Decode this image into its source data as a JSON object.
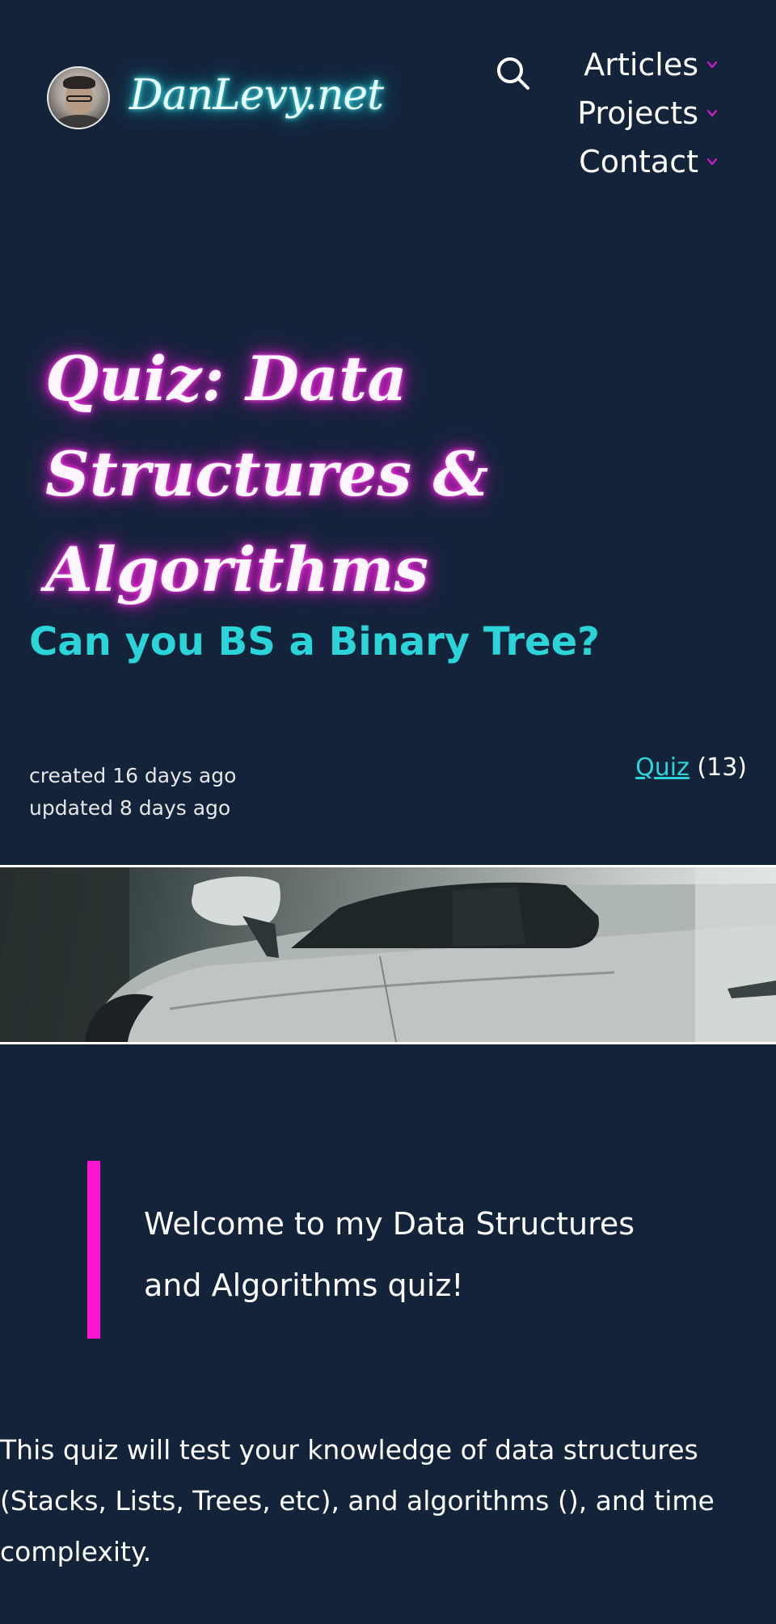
{
  "header": {
    "site_title": "DanLevy.net",
    "nav": [
      {
        "label": "Articles"
      },
      {
        "label": "Projects"
      },
      {
        "label": "Contact"
      }
    ]
  },
  "article": {
    "title": "Quiz: Data Structures & Algorithms",
    "subtitle": "Can you BS a Binary Tree?",
    "created": "created 16 days ago",
    "updated": "updated 8 days ago",
    "tag_label": "Quiz",
    "tag_count": "(13)",
    "quote": "Welcome to my Data Structures and Algorithms quiz!",
    "body": "This quiz will test your knowledge of data structures (Stacks, Lists, Trees, etc), and algorithms (), and time complexity."
  },
  "icons": {
    "search": "search-icon",
    "chevron": "chevron-down-icon",
    "avatar": "avatar",
    "banner": "car-banner-image"
  },
  "colors": {
    "background": "#13233a",
    "accent_cyan": "#2bd4d9",
    "accent_magenta": "#ff14cf",
    "title_glow": "#e81ed6",
    "logo_glow": "#26c6d3"
  }
}
